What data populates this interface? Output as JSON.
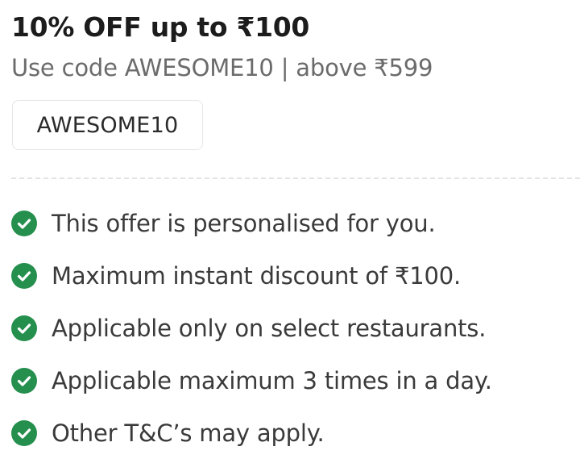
{
  "offer": {
    "title": "10% OFF up to ₹100",
    "subtitle": "Use code AWESOME10 | above ₹599",
    "code": "AWESOME10"
  },
  "terms": [
    {
      "text": "This offer is personalised for you."
    },
    {
      "text": "Maximum instant discount of ₹100."
    },
    {
      "text": "Applicable only on select restaurants."
    },
    {
      "text": "Applicable maximum 3 times in a day."
    },
    {
      "text": "Other T&C’s may apply."
    }
  ],
  "icons": {
    "check": "check-circle-icon"
  },
  "colors": {
    "check_green": "#258f4e",
    "title": "#1c1c1c",
    "subtitle": "#6b6b6b",
    "body": "#3a3a3a"
  }
}
